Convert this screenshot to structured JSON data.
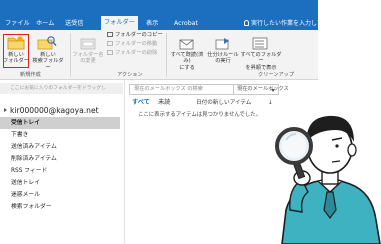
{
  "ribbon": {
    "tabs": [
      {
        "label": "ファイル",
        "active": false
      },
      {
        "label": "ホーム",
        "active": false
      },
      {
        "label": "送受信",
        "active": false
      },
      {
        "label": "フォルダー",
        "active": true
      },
      {
        "label": "表示",
        "active": false
      },
      {
        "label": "Acrobat",
        "active": false
      }
    ],
    "tell_me": "実行したい作業を入力して",
    "buttons": {
      "new_folder": "新しい\nフォルダー",
      "new_search_folder": "新しい\n検索フォルダー",
      "rename_folder": "フォルダー名\nの変更",
      "copy_folder": "フォルダーのコピー",
      "move_folder": "フォルダーの移動",
      "delete_folder": "フォルダーの削除",
      "mark_all_read": "すべて既読(済み)\nにする",
      "run_rules": "仕分けルール\nの実行",
      "show_all_folders": "すべてのフォルダー\nを昇順で表示"
    },
    "groups": {
      "new": "新規作成",
      "actions": "アクション",
      "cleanup": "クリーンアップ"
    }
  },
  "folder_pane": {
    "favorites_hint": "ここにお気に入りのフォルダーをドラッグし",
    "account": "kir000000@kagoya.net",
    "folders": [
      {
        "label": "受信トレイ",
        "selected": true
      },
      {
        "label": "下書き",
        "selected": false
      },
      {
        "label": "送信済みアイテム",
        "selected": false
      },
      {
        "label": "削除済みアイテム",
        "selected": false
      },
      {
        "label": "RSS フィード",
        "selected": false
      },
      {
        "label": "送信トレイ",
        "selected": false
      },
      {
        "label": "迷惑メール",
        "selected": false
      },
      {
        "label": "検索フォルダー",
        "selected": false
      }
    ]
  },
  "message_pane": {
    "search_placeholder": "現在のメールボックス の検索",
    "search_scope": "現在のメールボックス",
    "filters": {
      "all": "すべて",
      "unread": "未読"
    },
    "sort": "日付の新しいアイテム",
    "sort_arrow": "↓",
    "empty_message": "ここに表示するアイテムは見つかりませんでした。"
  },
  "colors": {
    "ribbon_blue": "#1c6fbf",
    "highlight_red": "#e02020",
    "folder_yellow": "#f4c542",
    "character_teal": "#3fb2c2"
  },
  "icons": [
    "new-folder-icon",
    "search-folder-icon",
    "rename-folder-icon",
    "mark-read-icon",
    "run-rules-icon",
    "show-folders-icon",
    "magnifier-icon"
  ]
}
